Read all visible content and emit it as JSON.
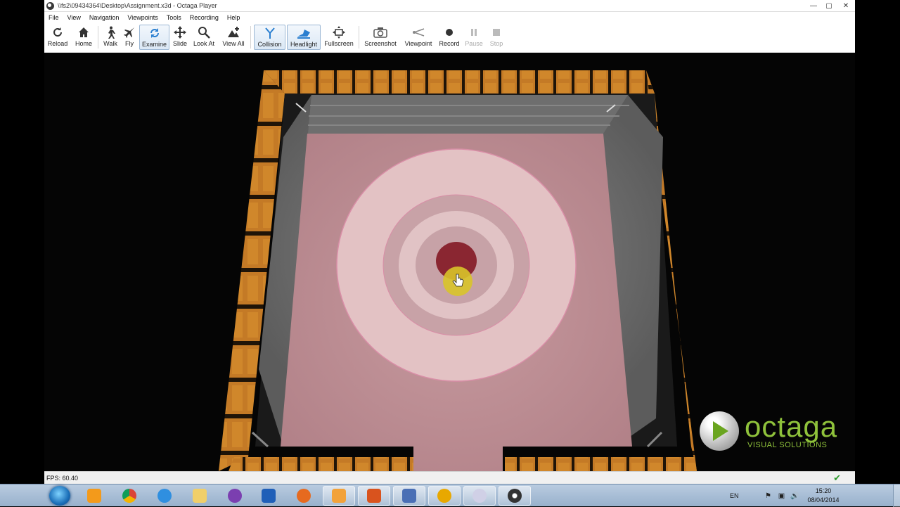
{
  "window": {
    "title": "\\\\fs2\\09434364\\Desktop\\Assignment.x3d - Octaga Player",
    "controls": {
      "minimize": "—",
      "maximize": "▢",
      "close": "✕"
    }
  },
  "menu": [
    "File",
    "View",
    "Navigation",
    "Viewpoints",
    "Tools",
    "Recording",
    "Help"
  ],
  "toolbar": {
    "reload": "Reload",
    "home": "Home",
    "walk": "Walk",
    "fly": "Fly",
    "examine": "Examine",
    "slide": "Slide",
    "look_at": "Look At",
    "view_all": "View All",
    "collision": "Collision",
    "headlight": "Headlight",
    "fullscreen": "Fullscreen",
    "screenshot": "Screenshot",
    "viewpoint": "Viewpoint",
    "record": "Record",
    "pause": "Pause",
    "stop": "Stop",
    "active_mode": "Examine",
    "toggled_on": [
      "Collision",
      "Headlight"
    ],
    "disabled": [
      "Pause",
      "Stop"
    ]
  },
  "logo": {
    "word": "octaga",
    "sub": "VISUAL SOLUTIONS",
    "color": "#8fc23b"
  },
  "status": {
    "fps": "FPS: 60.40",
    "ok_icon": "checkmark-icon"
  },
  "taskbar": {
    "apps": [
      "start-orb",
      "media-player",
      "chrome",
      "internet-explorer",
      "file-explorer",
      "media-center",
      "word",
      "firefox",
      "shortcut-app",
      "matlab",
      "visual-studio",
      "headphones-app",
      "disc-app",
      "octaga-player"
    ],
    "language": "EN",
    "time": "15:20",
    "date": "08/04/2014"
  }
}
